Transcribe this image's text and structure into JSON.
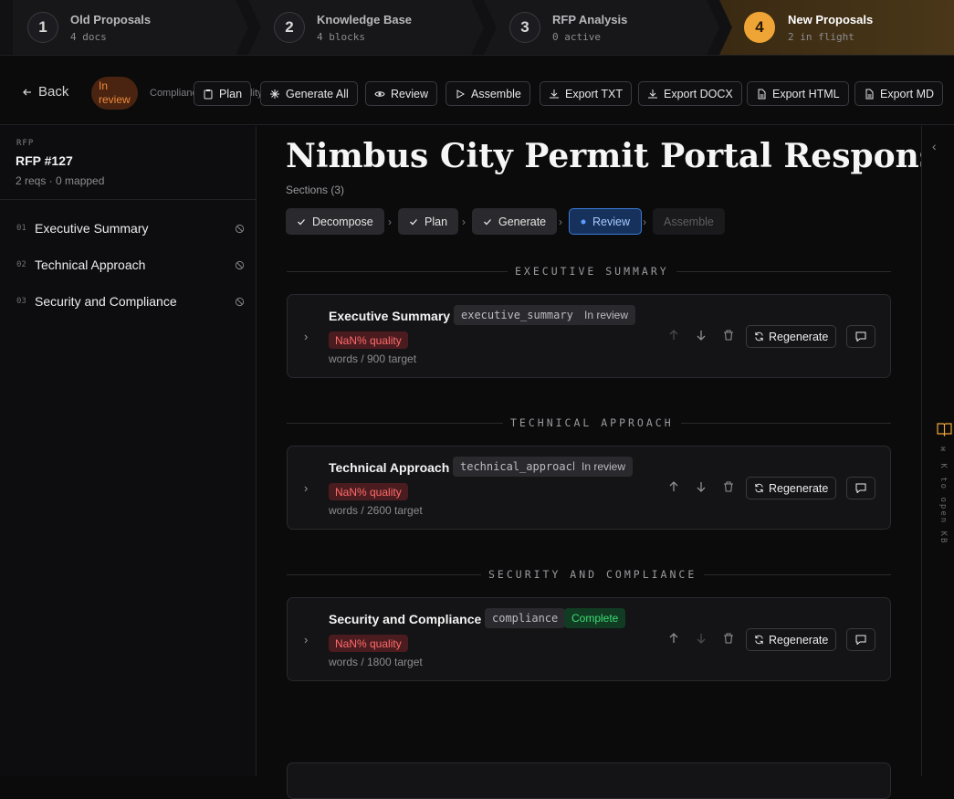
{
  "stepper": [
    {
      "num": "1",
      "title": "Old Proposals",
      "sub": "4 docs"
    },
    {
      "num": "2",
      "title": "Knowledge Base",
      "sub": "4 blocks"
    },
    {
      "num": "3",
      "title": "RFP Analysis",
      "sub": "0 active"
    },
    {
      "num": "4",
      "title": "New Proposals",
      "sub": "2 in flight"
    }
  ],
  "toolbar": {
    "back_label": "Back",
    "status_badge": "In review",
    "meta_text": "Compliance: 0/2 · Quality: 0",
    "buttons": {
      "plan": "Plan",
      "generate_all": "Generate All",
      "review": "Review",
      "assemble": "Assemble",
      "export_txt": "Export TXT",
      "export_docx": "Export DOCX",
      "export_html": "Export HTML",
      "export_md": "Export MD"
    }
  },
  "sidebar": {
    "eyebrow": "RFP",
    "title": "RFP #127",
    "meta": "2 reqs · 0 mapped",
    "items": [
      {
        "num": "01",
        "label": "Executive Summary"
      },
      {
        "num": "02",
        "label": "Technical Approach"
      },
      {
        "num": "03",
        "label": "Security and Compliance"
      }
    ]
  },
  "main": {
    "title": "Nimbus City Permit Portal Response",
    "sections_count": "Sections (3)",
    "pipeline": {
      "decompose": "Decompose",
      "plan": "Plan",
      "generate": "Generate",
      "review": "Review",
      "assemble": "Assemble"
    },
    "sections": [
      {
        "divider": "EXECUTIVE SUMMARY",
        "title": "Executive Summary",
        "key": "executive_summary",
        "status": "In review",
        "quality": "NaN% quality",
        "words": "words / 900 target",
        "regenerate": "Regenerate"
      },
      {
        "divider": "TECHNICAL APPROACH",
        "title": "Technical Approach",
        "key": "technical_approach",
        "status": "In review",
        "quality": "NaN% quality",
        "words": "words / 2600 target",
        "regenerate": "Regenerate"
      },
      {
        "divider": "SECURITY AND COMPLIANCE",
        "title": "Security and Compliance",
        "key": "compliance",
        "status": "Complete",
        "quality": "NaN% quality",
        "words": "words / 1800 target",
        "regenerate": "Regenerate"
      }
    ]
  },
  "rail": {
    "hint": "⌘ K to open KB"
  },
  "colors": {
    "accent": "#efa536",
    "review_blue": "#3b78d6",
    "complete_green": "#3ddc74",
    "quality_red": "#ff6b6b",
    "in_review_orange": "#f08a3c"
  }
}
